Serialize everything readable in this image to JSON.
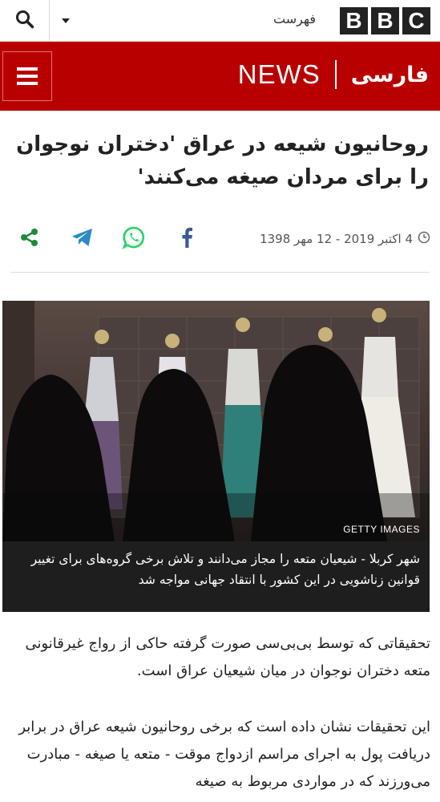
{
  "header": {
    "menu_label": "فهرست",
    "logo_letters": [
      "B",
      "B",
      "C"
    ],
    "brand_news": "NEWS",
    "brand_language": "فارسی"
  },
  "article": {
    "headline": "روحانیون شیعه در عراق 'دختران نوجوان را برای مردان صیغه می‌کنند'",
    "date": "4 اکتبر 2019 - 12 مهر 1398",
    "image_credit": "GETTY IMAGES",
    "image_caption": "شهر کربلا - شیعیان متعه را مجاز می‌دانند و تلاش برخی گروه‌های برای تغییر قوانین زناشویی در این کشور با انتقاد جهانی مواجه شد",
    "paragraphs": [
      "تحقیقاتی که توسط بی‌بی‌سی صورت گرفته حاکی از رواج غیرقانونی متعه دختران نوجوان در میان شیعیان عراق است.",
      "این تحقیقات نشان داده است که برخی روحانیون شیعه عراق در برابر دریافت پول به اجرای مراسم ازدواج موقت - متعه یا صیغه - مبادرت می‌ورزند که در مواردی مربوط به صیغه"
    ]
  },
  "share": {
    "icons": [
      "share-icon",
      "telegram-icon",
      "whatsapp-icon",
      "facebook-icon"
    ]
  },
  "colors": {
    "brand_red": "#b80000",
    "facebook": "#3b5998",
    "whatsapp": "#25d366",
    "telegram": "#2a8bc4",
    "share": "#1e8a3c"
  }
}
